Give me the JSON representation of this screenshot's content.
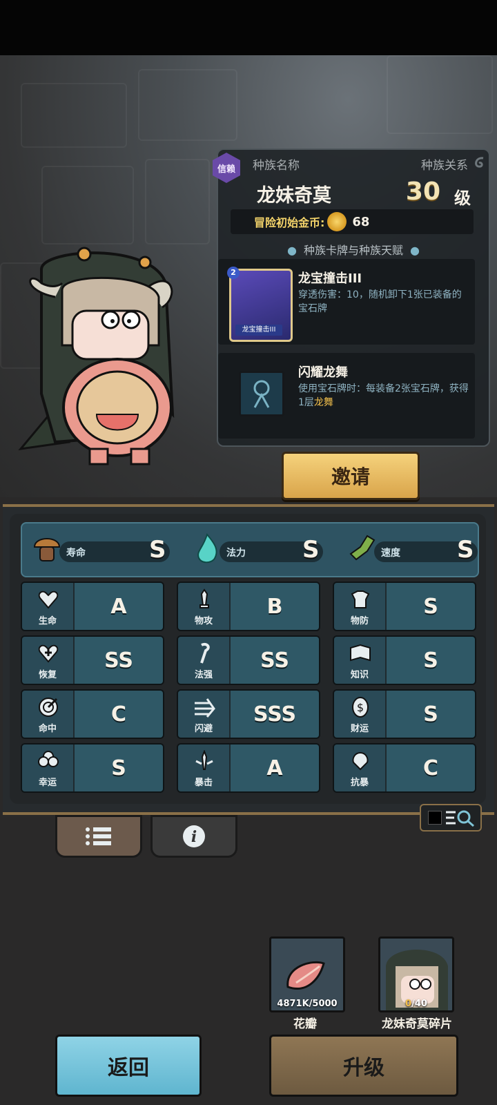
{
  "race_panel": {
    "trust_badge": "信赖",
    "race_name_label": "种族名称",
    "race_relation_label": "种族关系",
    "race_name": "龙妹奇莫",
    "level_value": "30",
    "level_unit": "级",
    "start_gold_label": "冒险初始金币:",
    "start_gold_value": "68",
    "section_title": "种族卡牌与种族天赋",
    "card": {
      "badge": "2",
      "thumb_label": "龙宝撞击III",
      "title": "龙宝撞击III",
      "desc": "穿透伤害：10，随机卸下1张已装备的宝石牌"
    },
    "talent": {
      "title": "闪耀龙舞",
      "desc_prefix": "使用宝石牌时：每装备2张宝石牌，获得1层",
      "desc_highlight": "龙舞"
    }
  },
  "invite_button": "邀请",
  "top_stats": [
    {
      "label": "寿命",
      "grade": "S",
      "icon": "mushroom-icon"
    },
    {
      "label": "法力",
      "grade": "S",
      "icon": "flame-icon"
    },
    {
      "label": "速度",
      "grade": "S",
      "icon": "wing-boot-icon"
    }
  ],
  "stats": [
    {
      "label": "生命",
      "grade": "A",
      "icon": "heart-icon"
    },
    {
      "label": "物攻",
      "grade": "B",
      "icon": "sword-icon"
    },
    {
      "label": "物防",
      "grade": "S",
      "icon": "armor-icon"
    },
    {
      "label": "恢复",
      "grade": "SS",
      "icon": "heart-plus-icon"
    },
    {
      "label": "法强",
      "grade": "SS",
      "icon": "staff-icon"
    },
    {
      "label": "知识",
      "grade": "S",
      "icon": "book-icon"
    },
    {
      "label": "命中",
      "grade": "C",
      "icon": "target-icon"
    },
    {
      "label": "闪避",
      "grade": "SSS",
      "icon": "arrows-icon"
    },
    {
      "label": "财运",
      "grade": "S",
      "icon": "coin-icon"
    },
    {
      "label": "幸运",
      "grade": "S",
      "icon": "clover-icon"
    },
    {
      "label": "暴击",
      "grade": "A",
      "icon": "crit-sword-icon"
    },
    {
      "label": "抗暴",
      "grade": "C",
      "icon": "shield-petal-icon"
    }
  ],
  "items": [
    {
      "name": "花瓣",
      "count": "4871K/5000",
      "icon": "petal-icon"
    },
    {
      "name": "龙妹奇莫碎片",
      "count_have": "0",
      "count_need": "/40",
      "icon": "portrait-icon"
    }
  ],
  "buttons": {
    "back": "返回",
    "upgrade": "升级"
  },
  "colors": {
    "gold_text": "#f3d36a",
    "highlight": "#f3c04c",
    "panel_teal": "#2f5866",
    "invite": "#f5d27c",
    "back": "#8fd3e6",
    "upgrade": "#8f7654"
  }
}
